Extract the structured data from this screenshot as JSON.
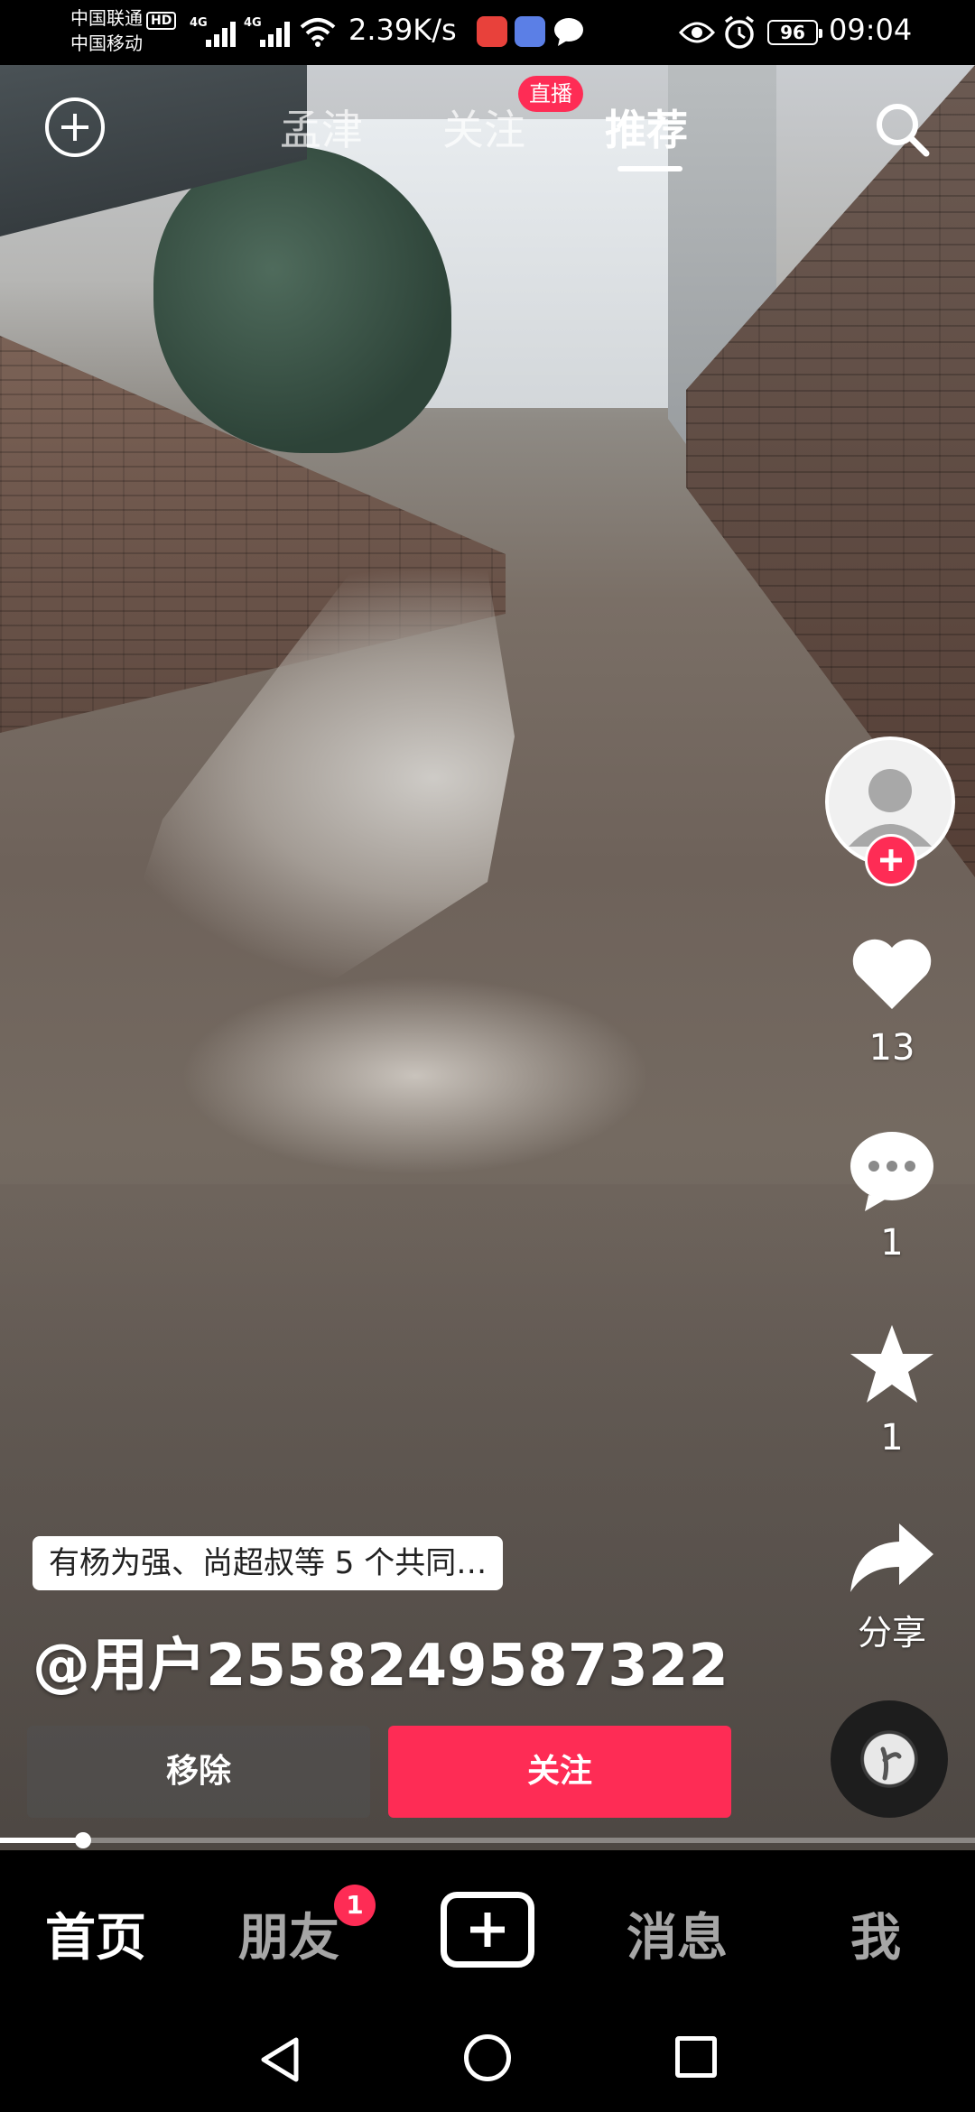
{
  "status_bar": {
    "carrier1": "中国联通",
    "carrier1_badge": "HD",
    "carrier2": "中国移动",
    "net_type1": "4G",
    "net_type2": "4G",
    "net_speed": "2.39K/s",
    "battery": "96",
    "time": "09:04"
  },
  "top_tabs": {
    "items": [
      "孟津",
      "关注",
      "推荐"
    ],
    "active": "推荐",
    "live_badge": "直播"
  },
  "actions": {
    "likes": "13",
    "comments": "1",
    "favorites": "1",
    "share": "分享"
  },
  "info": {
    "mutual_friends": "有杨为强、尚超叔等 5 个共同…",
    "username": "@用户2558249587322",
    "remove_button": "移除",
    "follow_button": "关注"
  },
  "progress": 0.085,
  "bottom_nav": {
    "items": [
      "首页",
      "朋友",
      "消息",
      "我"
    ],
    "active": "首页",
    "friends_badge": "1"
  },
  "colors": {
    "accent": "#fe2c55",
    "background": "#000000"
  },
  "icons": [
    "add-circle-icon",
    "search-icon",
    "heart-icon",
    "comment-icon",
    "star-icon",
    "share-icon",
    "music-disc-icon",
    "create-plus-icon",
    "back-icon",
    "home-icon",
    "recent-apps-icon"
  ]
}
